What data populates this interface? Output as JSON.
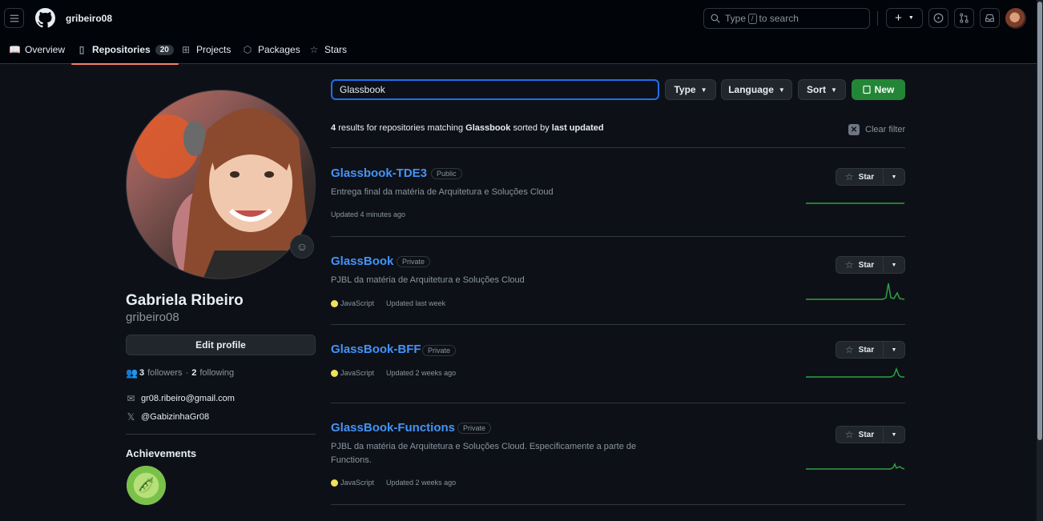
{
  "header": {
    "username": "gribeiro08",
    "search": {
      "prefix": "Type",
      "key": "/",
      "suffix": "to search"
    },
    "plus_label": "+"
  },
  "tabs": [
    {
      "label": "Overview",
      "icon": "book-icon"
    },
    {
      "label": "Repositories",
      "icon": "repo-icon",
      "counter": "20"
    },
    {
      "label": "Projects",
      "icon": "table-icon"
    },
    {
      "label": "Packages",
      "icon": "package-icon"
    },
    {
      "label": "Stars",
      "icon": "star-icon"
    }
  ],
  "profile": {
    "name": "Gabriela Ribeiro",
    "login": "gribeiro08",
    "edit_label": "Edit profile",
    "followers_count": "3",
    "followers_label": "followers",
    "following_count": "2",
    "following_label": "following",
    "email": "gr08.ribeiro@gmail.com",
    "twitter": "@GabizinhaGr08",
    "achievements_title": "Achievements"
  },
  "filters": {
    "query": "Glassbook",
    "type_label": "Type",
    "language_label": "Language",
    "sort_label": "Sort",
    "new_label": "New",
    "results_count": "4",
    "results_text": "results for repositories matching",
    "results_query": "Glassbook",
    "results_sorted": "sorted by",
    "results_sort_key": "last updated",
    "clear_label": "Clear filter"
  },
  "repos": [
    {
      "name": "Glassbook-TDE3",
      "visibility": "Public",
      "description": "Entrega final da matéria de Arquitetura e Soluções Cloud",
      "language": "",
      "updated": "Updated 4 minutes ago",
      "star_label": "Star"
    },
    {
      "name": "GlassBook",
      "visibility": "Private",
      "description": "PJBL da matéria de Arquitetura e Soluções Cloud",
      "language": "JavaScript",
      "updated": "Updated last week",
      "star_label": "Star"
    },
    {
      "name": "GlassBook-BFF",
      "visibility": "Private",
      "description": "",
      "language": "JavaScript",
      "updated": "Updated 2 weeks ago",
      "star_label": "Star"
    },
    {
      "name": "GlassBook-Functions",
      "visibility": "Private",
      "description": "PJBL da matéria de Arquitetura e Soluções Cloud. Especificamente a parte de Functions.",
      "language": "JavaScript",
      "updated": "Updated 2 weeks ago",
      "star_label": "Star"
    }
  ],
  "colors": {
    "accent": "#4493f8",
    "new_button": "#238636",
    "active_tab": "#f78166",
    "javascript": "#f1e05a",
    "sparkline": "#2ea043"
  }
}
